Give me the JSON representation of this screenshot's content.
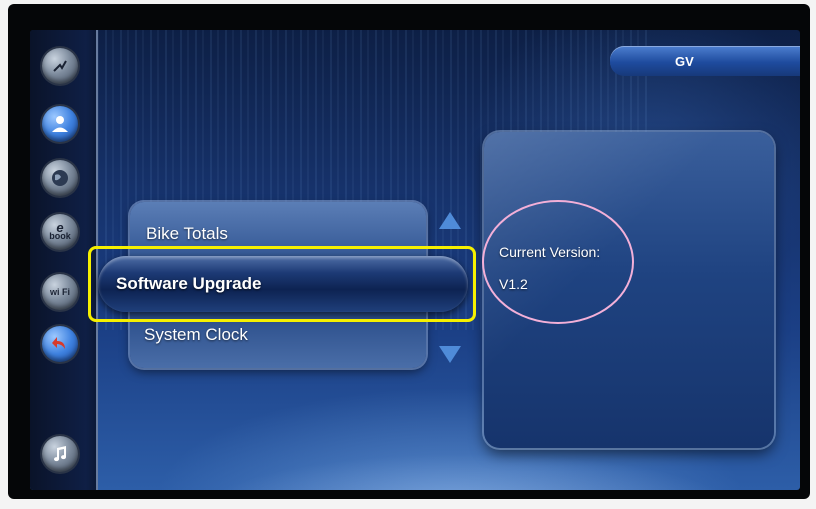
{
  "header": {
    "tab_label": "GV"
  },
  "sidebar": {
    "items": [
      {
        "icon": "dashboard-icon",
        "active": false
      },
      {
        "icon": "user-profile-icon",
        "active": true
      },
      {
        "icon": "globe-icon",
        "active": false
      },
      {
        "icon": "ebook-icon",
        "label_top": "e",
        "label_bottom": "book",
        "active": false
      },
      {
        "icon": "wifi-icon",
        "label": "wi Fi",
        "active": false
      },
      {
        "icon": "back-arrow-icon",
        "active": false
      },
      {
        "icon": "music-note-icon",
        "active": false
      }
    ]
  },
  "menu": {
    "items": [
      {
        "label": "Bike Totals"
      },
      {
        "label": "Software Upgrade",
        "selected": true
      },
      {
        "label": "System Clock"
      }
    ]
  },
  "info": {
    "version_label": "Current Version:",
    "version_value": "V1.2"
  },
  "colors": {
    "highlight": "#f6f000",
    "annotation": "#f3b0d8",
    "accent": "#4f8bd8"
  }
}
